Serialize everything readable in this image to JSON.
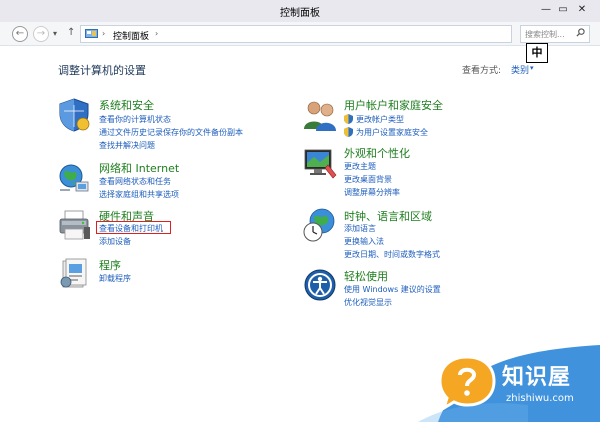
{
  "window": {
    "title": "控制面板",
    "min_glyph": "—",
    "max_glyph": "▭",
    "close_glyph": "✕"
  },
  "nav": {
    "back_glyph": "←",
    "forward_glyph": "→",
    "dropdown_glyph": "▾",
    "up_glyph": "↑",
    "breadcrumb_sep": "›",
    "breadcrumb": "控制面板",
    "refresh_glyph": "↻",
    "search_placeholder": "搜索控制..."
  },
  "ime": {
    "label": "中"
  },
  "main": {
    "heading": "调整计算机的设置",
    "view_by_label": "查看方式:",
    "view_by_value": "类别",
    "view_by_arrow": "▾"
  },
  "categories": [
    {
      "title": "系统和安全",
      "icon": "shield-icon",
      "links": [
        "查看你的计算机状态",
        "通过文件历史记录保存你的文件备份副本",
        "查找并解决问题"
      ]
    },
    {
      "title": "网络和 Internet",
      "icon": "globe-network-icon",
      "links": [
        "查看网络状态和任务",
        "选择家庭组和共享选项"
      ]
    },
    {
      "title": "硬件和声音",
      "icon": "printer-icon",
      "links": [
        "查看设备和打印机",
        "添加设备"
      ]
    },
    {
      "title": "程序",
      "icon": "programs-icon",
      "links": [
        "卸载程序"
      ]
    },
    {
      "title": "用户帐户和家庭安全",
      "icon": "users-icon",
      "links": [
        "更改帐户类型",
        "为用户设置家庭安全"
      ]
    },
    {
      "title": "外观和个性化",
      "icon": "monitor-icon",
      "links": [
        "更改主题",
        "更改桌面背景",
        "调整屏幕分辨率"
      ]
    },
    {
      "title": "时钟、语言和区域",
      "icon": "clock-globe-icon",
      "links": [
        "添加语言",
        "更换输入法",
        "更改日期、时间或数字格式"
      ]
    },
    {
      "title": "轻松使用",
      "icon": "accessibility-icon",
      "links": [
        "使用 Windows 建议的设置",
        "优化视觉显示"
      ]
    }
  ],
  "watermark": {
    "name": "知识屋",
    "domain": "zhishiwu.com",
    "brand_color": "#1e7fd6"
  },
  "colors": {
    "link": "#1e5ebd",
    "category_title": "#1e7e1e",
    "highlight": "#e02020"
  }
}
